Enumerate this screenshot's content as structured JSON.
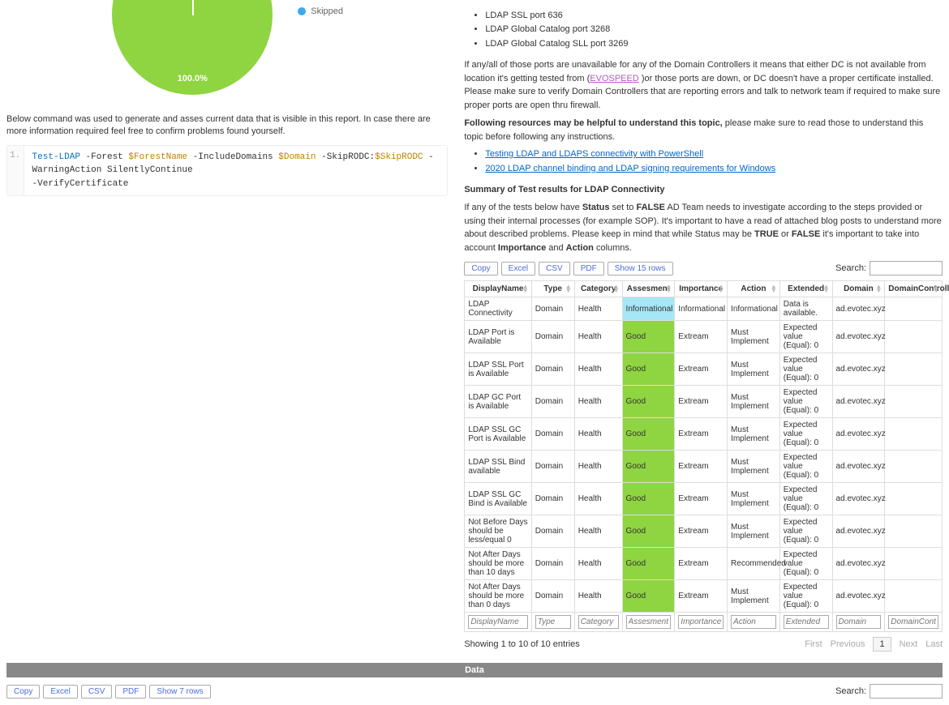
{
  "chart_data": {
    "type": "pie",
    "title": "",
    "series": [
      {
        "name": "Skipped",
        "values": [
          100.0
        ],
        "color": "#8fd441"
      }
    ],
    "center_label": "100.0%",
    "legend": [
      {
        "label": "Skipped",
        "color": "#3ba9ee"
      }
    ]
  },
  "left": {
    "cmd_intro": "Below command was used to generate and asses current data that is visible in this report. In case there are more information required feel free to confirm problems found yourself.",
    "code": {
      "line_no": "1.",
      "cmd": "Test-LDAP",
      "p_forest": "-Forest",
      "v_forest": "$ForestName",
      "p_incl": "-IncludeDomains",
      "v_domain": "$Domain",
      "p_skip": "-SkipRODC:",
      "v_skip": "$SkipRODC",
      "p_warn": "-WarningAction",
      "v_warn": "SilentlyContinue",
      "p_verify": "-VerifyCertificate"
    }
  },
  "right": {
    "ports": [
      "LDAP SSL port 636",
      "LDAP Global Catalog port 3268",
      "LDAP Global Catalog SLL port 3269"
    ],
    "para1_a": "If any/all of those ports are unavailable for any of the Domain Controllers it means that either DC is not available from location it's getting tested from (",
    "para1_link": "EVOSPEED",
    "para1_b": " )or those ports are down, or DC doesn't have a proper certificate installed. Please make sure to verify Domain Controllers that are reporting errors and talk to network team if required to make sure proper ports are open thru firewall.",
    "res_head": "Following resources may be helpful to understand this topic,",
    "res_tail": " please make sure to read those to understand this topic before following any instructions.",
    "links": [
      "Testing LDAP and LDAPS connectivity with PowerShell",
      "2020 LDAP channel binding and LDAP signing requirements for Windows"
    ],
    "summary_head": "Summary of Test results for LDAP Connectivity",
    "summary_a": "If any of the tests below have ",
    "summary_b": "Status",
    "summary_c": " set to ",
    "summary_d": "FALSE",
    "summary_e": " AD Team needs to investigate according to the steps provided or using their internal processes (for example SOP). It's important to have a read of attached blog posts to understand more about described problems. Please keep in mind that while Status may be ",
    "summary_f": "TRUE",
    "summary_g": " or ",
    "summary_h": "FALSE",
    "summary_i": " it's important to take into account ",
    "summary_j": "Importance",
    "summary_k": " and ",
    "summary_l": "Action",
    "summary_m": " columns."
  },
  "buttons": {
    "copy": "Copy",
    "excel": "Excel",
    "csv": "CSV",
    "pdf": "PDF",
    "show15": "Show 15 rows",
    "show7": "Show 7 rows"
  },
  "search_label": "Search:",
  "table": {
    "headers": [
      "DisplayName",
      "Type",
      "Category",
      "Assesment",
      "Importance",
      "Action",
      "Extended",
      "Domain",
      "DomainController"
    ],
    "rows": [
      {
        "name": "LDAP Connectivity",
        "type": "Domain",
        "cat": "Health",
        "assess": "Informational",
        "assess_cls": "info",
        "imp": "Informational",
        "act": "Informational",
        "ext": "Data is available.",
        "dom": "ad.evotec.xyz"
      },
      {
        "name": "LDAP Port is Available",
        "type": "Domain",
        "cat": "Health",
        "assess": "Good",
        "assess_cls": "good",
        "imp": "Extream",
        "act": "Must Implement",
        "ext": "Expected value (Equal): 0",
        "dom": "ad.evotec.xyz"
      },
      {
        "name": "LDAP SSL Port is Available",
        "type": "Domain",
        "cat": "Health",
        "assess": "Good",
        "assess_cls": "good",
        "imp": "Extream",
        "act": "Must Implement",
        "ext": "Expected value (Equal): 0",
        "dom": "ad.evotec.xyz"
      },
      {
        "name": "LDAP GC Port is Available",
        "type": "Domain",
        "cat": "Health",
        "assess": "Good",
        "assess_cls": "good",
        "imp": "Extream",
        "act": "Must Implement",
        "ext": "Expected value (Equal): 0",
        "dom": "ad.evotec.xyz"
      },
      {
        "name": "LDAP SSL GC Port is Available",
        "type": "Domain",
        "cat": "Health",
        "assess": "Good",
        "assess_cls": "good",
        "imp": "Extream",
        "act": "Must Implement",
        "ext": "Expected value (Equal): 0",
        "dom": "ad.evotec.xyz"
      },
      {
        "name": "LDAP SSL Bind available",
        "type": "Domain",
        "cat": "Health",
        "assess": "Good",
        "assess_cls": "good",
        "imp": "Extream",
        "act": "Must Implement",
        "ext": "Expected value (Equal): 0",
        "dom": "ad.evotec.xyz"
      },
      {
        "name": "LDAP SSL GC Bind is Available",
        "type": "Domain",
        "cat": "Health",
        "assess": "Good",
        "assess_cls": "good",
        "imp": "Extream",
        "act": "Must Implement",
        "ext": "Expected value (Equal): 0",
        "dom": "ad.evotec.xyz"
      },
      {
        "name": "Not Before Days should be less/equal 0",
        "type": "Domain",
        "cat": "Health",
        "assess": "Good",
        "assess_cls": "good",
        "imp": "Extream",
        "act": "Must Implement",
        "ext": "Expected value (Equal): 0",
        "dom": "ad.evotec.xyz"
      },
      {
        "name": "Not After Days should be more than 10 days",
        "type": "Domain",
        "cat": "Health",
        "assess": "Good",
        "assess_cls": "good",
        "imp": "Extream",
        "act": "Recommended",
        "ext": "Expected value (Equal): 0",
        "dom": "ad.evotec.xyz"
      },
      {
        "name": "Not After Days should be more than 0 days",
        "type": "Domain",
        "cat": "Health",
        "assess": "Good",
        "assess_cls": "good",
        "imp": "Extream",
        "act": "Must Implement",
        "ext": "Expected value (Equal): 0",
        "dom": "ad.evotec.xyz"
      }
    ],
    "footer_ph": [
      "DisplayName",
      "Type",
      "Category",
      "Assesment",
      "Importance",
      "Action",
      "Extended",
      "Domain",
      "DomainController"
    ],
    "showing": "Showing 1 to 10 of 10 entries",
    "pager": {
      "first": "First",
      "prev": "Previous",
      "pg": "1",
      "next": "Next",
      "last": "Last"
    }
  },
  "data_bar": "Data"
}
